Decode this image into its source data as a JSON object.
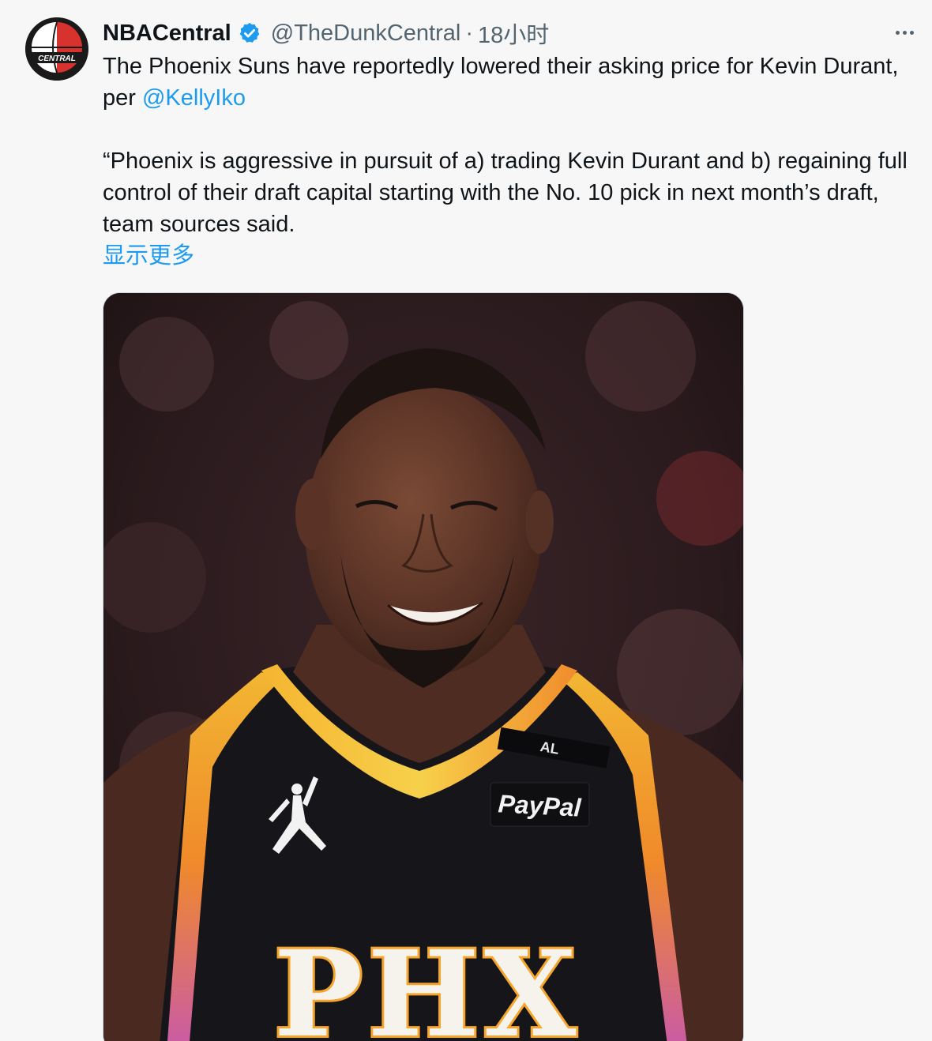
{
  "tweet": {
    "display_name": "NBACentral",
    "handle": "@TheDunkCentral",
    "separator": "·",
    "time": "18小时",
    "avatar_text": "CENTRAL",
    "text_line1_before": "The Phoenix Suns have reportedly lowered their asking price for Kevin Durant, per ",
    "mention": "@KellyIko",
    "quote": "“Phoenix is aggressive in pursuit of a) trading Kevin Durant and b) regaining full control of their draft capital starting with the No. 10 pick in next month’s draft, team sources said.",
    "show_more": "显示更多"
  },
  "media": {
    "jersey_patch": "AL",
    "sponsor": "PayPal",
    "jersey_text": "PHX"
  },
  "colors": {
    "link": "#1d9bf0",
    "verified": "#1d9bf0",
    "secondary_text": "#536471",
    "background": "#f7f7f7"
  },
  "icons": {
    "verified": "verified-badge-icon",
    "more": "more-dots-icon"
  }
}
